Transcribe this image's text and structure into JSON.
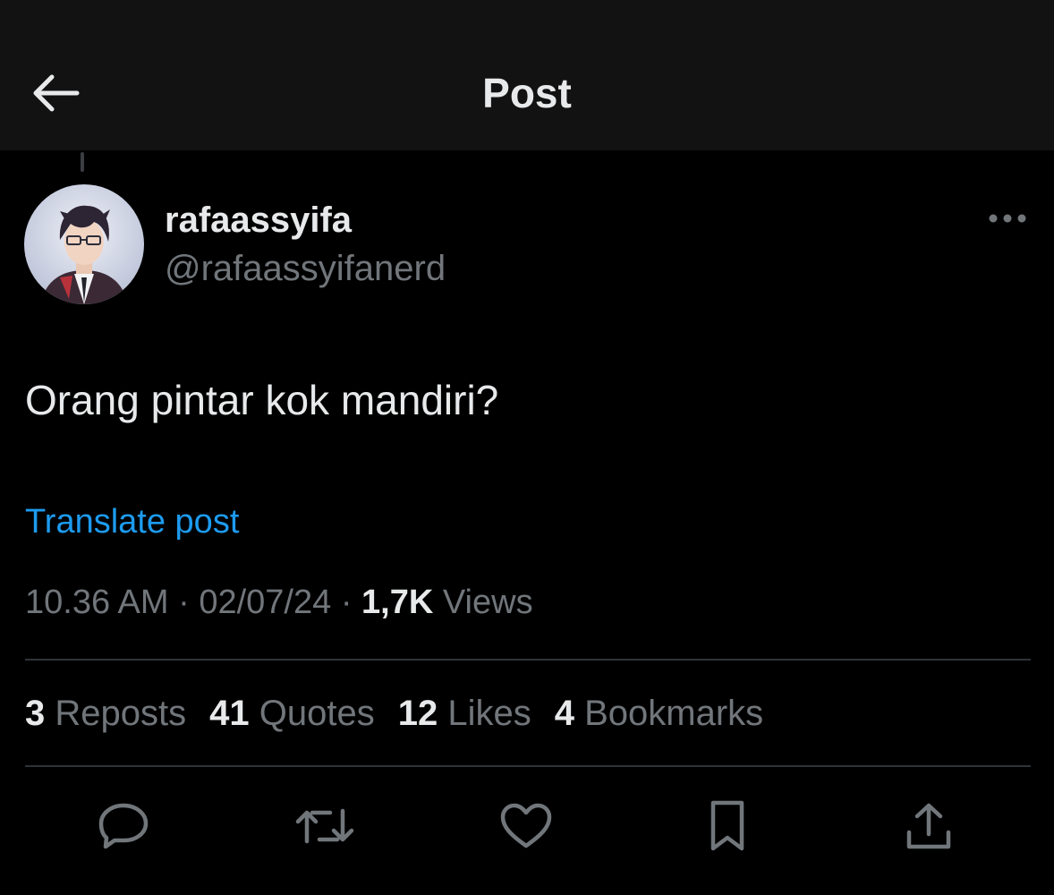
{
  "header": {
    "title": "Post",
    "back_icon": "arrow-left-icon"
  },
  "author": {
    "display_name": "rafaassyifa",
    "handle": "@rafaassyifanerd",
    "avatar_icon": "avatar-anime-character"
  },
  "post": {
    "text": "Orang pintar kok mandiri?",
    "translate_label": "Translate post",
    "time": "10.36 AM",
    "separator": "·",
    "date": "02/07/24",
    "views_count": "1,7K",
    "views_label": "Views"
  },
  "stats": [
    {
      "count": "3",
      "label": "Reposts"
    },
    {
      "count": "41",
      "label": "Quotes"
    },
    {
      "count": "12",
      "label": "Likes"
    },
    {
      "count": "4",
      "label": "Bookmarks"
    }
  ],
  "actions": [
    "reply-icon",
    "repost-icon",
    "like-icon",
    "bookmark-icon",
    "share-icon"
  ],
  "colors": {
    "background": "#000000",
    "header_background": "#121212",
    "text_primary": "#e7e9ea",
    "text_secondary": "#71767b",
    "link": "#1d9bf0",
    "divider": "#2f3336"
  }
}
